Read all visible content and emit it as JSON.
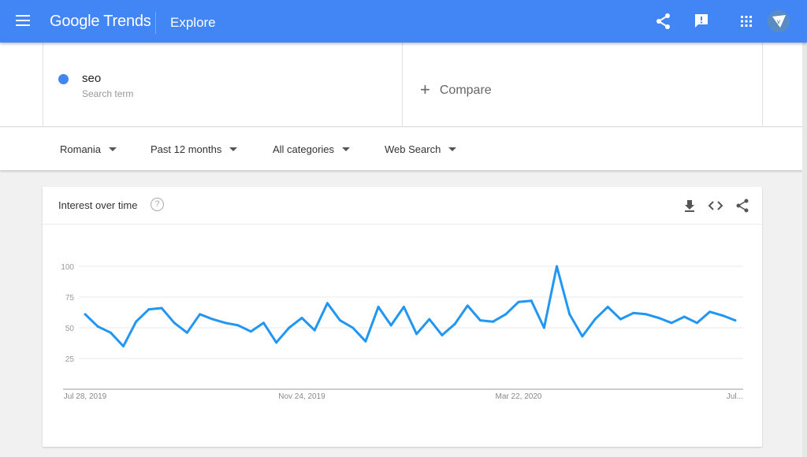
{
  "header": {
    "logo": "Google Trends",
    "section": "Explore",
    "icons": [
      "menu-icon",
      "share-icon",
      "feedback-icon",
      "apps-icon",
      "avatar"
    ]
  },
  "search": {
    "term": "seo",
    "term_type": "Search term",
    "term_color": "#4285f4",
    "compare_label": "Compare"
  },
  "filters": [
    {
      "label": "Romania"
    },
    {
      "label": "Past 12 months"
    },
    {
      "label": "All categories"
    },
    {
      "label": "Web Search"
    }
  ],
  "card": {
    "title": "Interest over time",
    "icons": [
      "download-icon",
      "embed-icon",
      "share-icon"
    ]
  },
  "colors": {
    "header": "#4285f4",
    "line": "#2196f3"
  },
  "chart_data": {
    "type": "line",
    "ylim": [
      0,
      100
    ],
    "yticks": [
      25,
      50,
      75,
      100
    ],
    "xtick_labels": [
      "Jul 28, 2019",
      "Nov 24, 2019",
      "Mar 22, 2020",
      "Jul..."
    ],
    "grid": true,
    "x": [
      "2019-07-28",
      "2019-08-04",
      "2019-08-11",
      "2019-08-18",
      "2019-08-25",
      "2019-09-01",
      "2019-09-08",
      "2019-09-15",
      "2019-09-22",
      "2019-09-29",
      "2019-10-06",
      "2019-10-13",
      "2019-10-20",
      "2019-10-27",
      "2019-11-03",
      "2019-11-10",
      "2019-11-17",
      "2019-11-24",
      "2019-12-01",
      "2019-12-08",
      "2019-12-15",
      "2019-12-22",
      "2019-12-29",
      "2020-01-05",
      "2020-01-12",
      "2020-01-19",
      "2020-01-26",
      "2020-02-02",
      "2020-02-09",
      "2020-02-16",
      "2020-02-23",
      "2020-03-01",
      "2020-03-08",
      "2020-03-15",
      "2020-03-22",
      "2020-03-29",
      "2020-04-05",
      "2020-04-12",
      "2020-04-19",
      "2020-04-26",
      "2020-05-03",
      "2020-05-10",
      "2020-05-17",
      "2020-05-24",
      "2020-05-31",
      "2020-06-07",
      "2020-06-14",
      "2020-06-21",
      "2020-06-28",
      "2020-07-05",
      "2020-07-12",
      "2020-07-19"
    ],
    "series": [
      {
        "values": [
          61,
          51,
          46,
          35,
          55,
          65,
          66,
          54,
          46,
          61,
          57,
          54,
          52,
          47,
          54,
          38,
          50,
          58,
          48,
          70,
          56,
          50,
          39,
          67,
          52,
          67,
          45,
          57,
          44,
          53,
          68,
          56,
          55,
          61,
          71,
          72,
          50,
          100,
          61,
          43,
          57,
          67,
          57,
          62,
          61,
          58,
          54,
          59,
          54,
          63,
          60,
          56
        ]
      }
    ]
  }
}
